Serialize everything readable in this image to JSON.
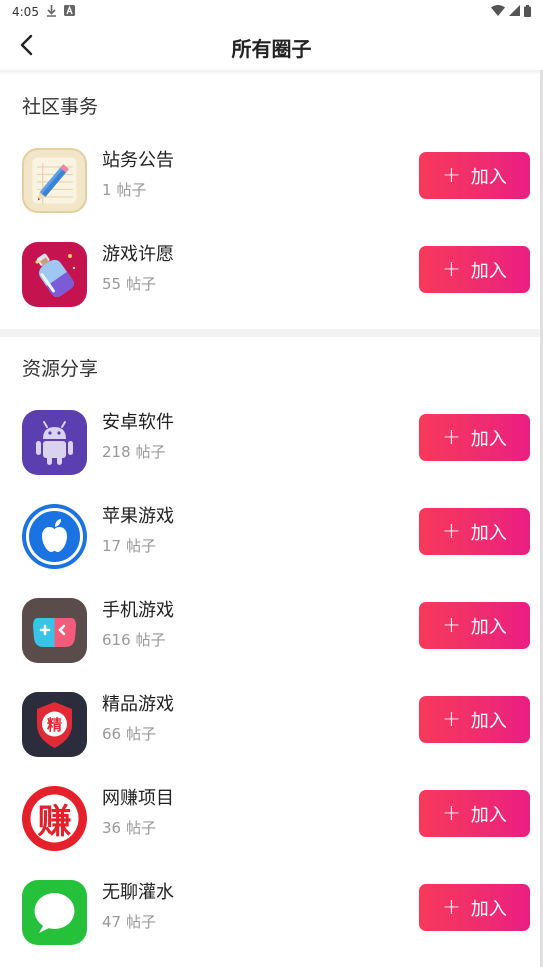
{
  "status_bar": {
    "time": "4:05",
    "left_icons": [
      "download-icon",
      "a-notification-icon"
    ],
    "right_icons": [
      "wifi-icon",
      "signal-icon",
      "battery-icon"
    ]
  },
  "header": {
    "title": "所有圈子",
    "back_icon": "chevron-left-icon"
  },
  "colors": {
    "join_gradient_start": "#f7395a",
    "join_gradient_end": "#ea1e83"
  },
  "sections": [
    {
      "title": "社区事务",
      "items": [
        {
          "name": "站务公告",
          "count": "1",
          "unit": "帖子",
          "icon": "notepad-pencil-icon",
          "join_label": "加入"
        },
        {
          "name": "游戏许愿",
          "count": "55",
          "unit": "帖子",
          "icon": "wish-bottle-icon",
          "join_label": "加入"
        }
      ]
    },
    {
      "title": "资源分享",
      "items": [
        {
          "name": "安卓软件",
          "count": "218",
          "unit": "帖子",
          "icon": "android-icon",
          "join_label": "加入"
        },
        {
          "name": "苹果游戏",
          "count": "17",
          "unit": "帖子",
          "icon": "apple-icon",
          "join_label": "加入"
        },
        {
          "name": "手机游戏",
          "count": "616",
          "unit": "帖子",
          "icon": "gamepad-icon",
          "join_label": "加入"
        },
        {
          "name": "精品游戏",
          "count": "66",
          "unit": "帖子",
          "icon": "premium-shield-icon",
          "join_label": "加入",
          "icon_text": "精"
        },
        {
          "name": "网赚项目",
          "count": "36",
          "unit": "帖子",
          "icon": "earn-money-icon",
          "join_label": "加入",
          "icon_text": "赚"
        },
        {
          "name": "无聊灌水",
          "count": "47",
          "unit": "帖子",
          "icon": "chat-bubble-icon",
          "join_label": "加入"
        }
      ]
    }
  ]
}
